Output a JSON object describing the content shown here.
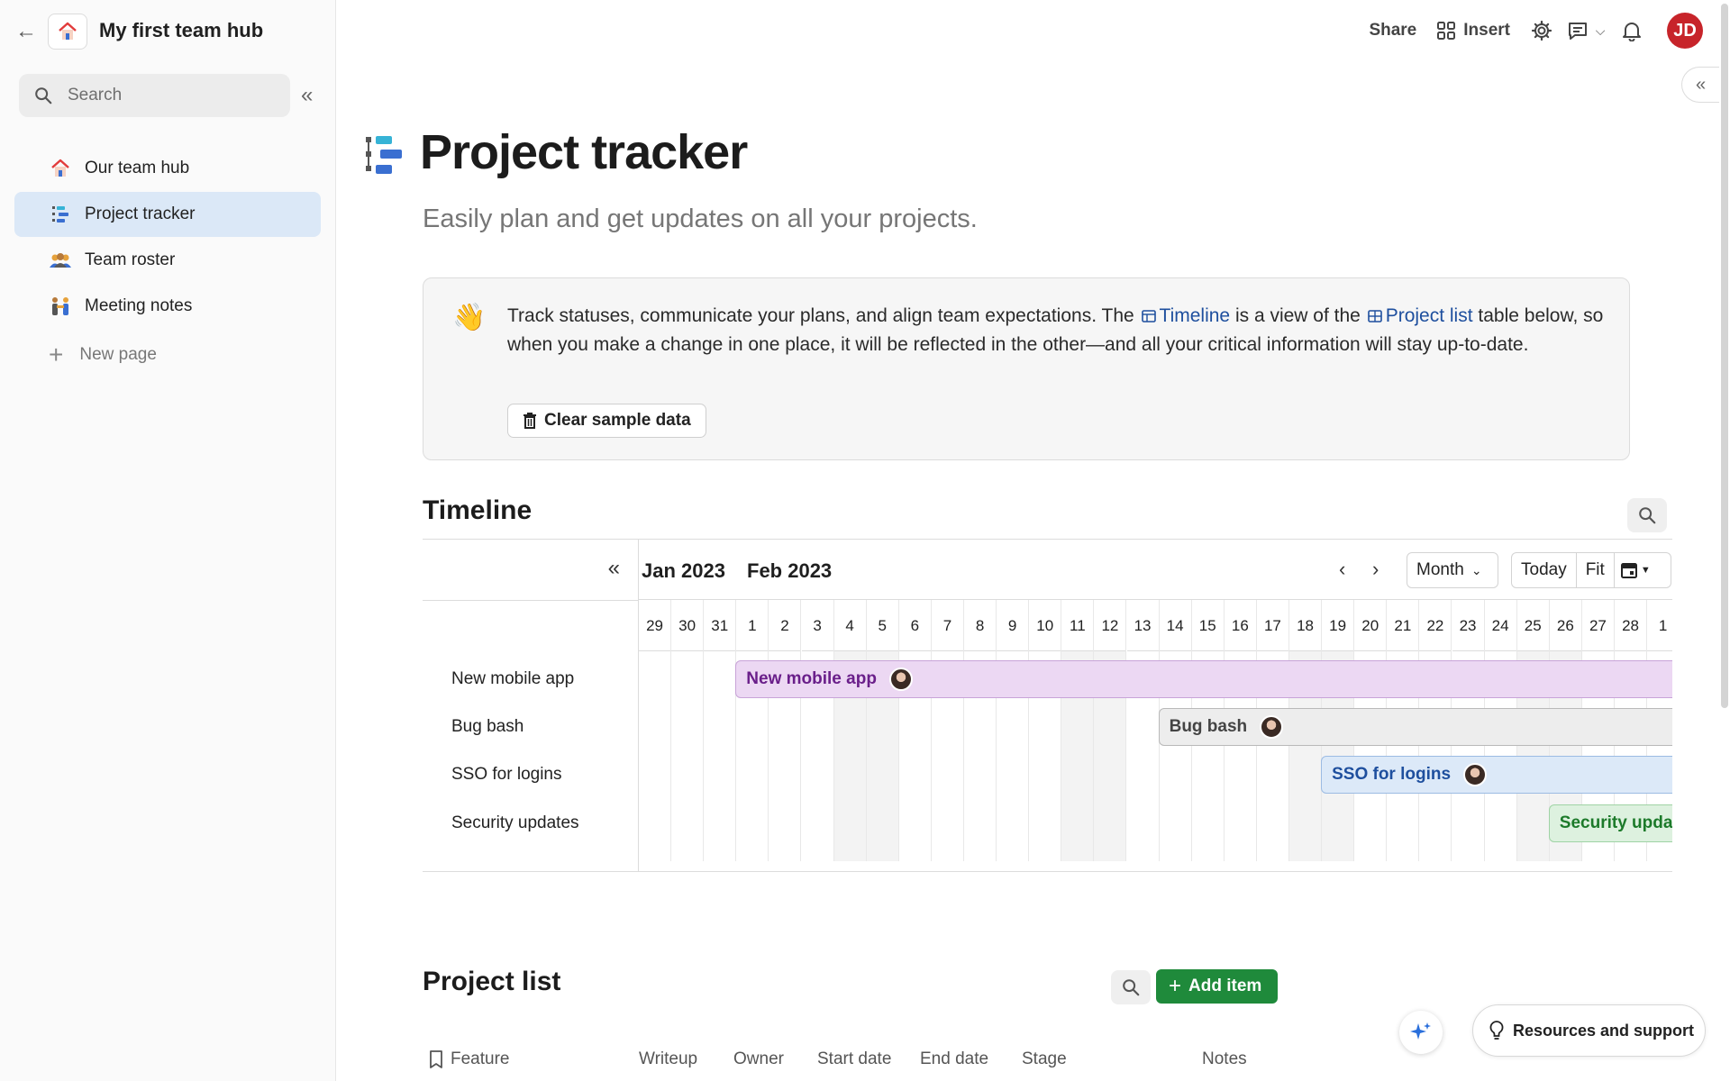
{
  "app": {
    "hub_title": "My first team hub"
  },
  "sidebar": {
    "search_placeholder": "Search",
    "items": [
      {
        "label": "Our team hub",
        "icon": "house-icon"
      },
      {
        "label": "Project tracker",
        "icon": "tracker-icon",
        "active": true
      },
      {
        "label": "Team roster",
        "icon": "people-icon"
      },
      {
        "label": "Meeting notes",
        "icon": "meeting-icon"
      }
    ],
    "new_page_label": "New page"
  },
  "topbar": {
    "share_label": "Share",
    "insert_label": "Insert",
    "avatar_initials": "JD",
    "avatar_color": "#c7242a"
  },
  "page": {
    "title": "Project tracker",
    "subtitle": "Easily plan and get updates on all your projects."
  },
  "callout": {
    "emoji": "👋",
    "text_1": "Track statuses, communicate your plans, and align team expectations. The",
    "link_timeline": "Timeline",
    "text_2": "is a view of the",
    "link_project_list": "Project list",
    "text_3": "table below, so when you make a change in one place, it will be reflected in the other—and all your critical information will stay up-to-date.",
    "clear_button": "Clear sample data"
  },
  "timeline": {
    "heading": "Timeline",
    "months": [
      "Jan 2023",
      "Feb 2023"
    ],
    "view_select": "Month",
    "today_label": "Today",
    "fit_label": "Fit",
    "days": [
      "29",
      "30",
      "31",
      "1",
      "2",
      "3",
      "4",
      "5",
      "6",
      "7",
      "8",
      "9",
      "10",
      "11",
      "12",
      "13",
      "14",
      "15",
      "16",
      "17",
      "18",
      "19",
      "20",
      "21",
      "22",
      "23",
      "24",
      "25",
      "26",
      "27",
      "28",
      "1"
    ],
    "weekend_indices": [
      6,
      7,
      13,
      14,
      20,
      21,
      27,
      28
    ],
    "rows": [
      {
        "label": "New mobile app",
        "bar_label": "New mobile app",
        "start_index": 3,
        "color": "purple"
      },
      {
        "label": "Bug bash",
        "bar_label": "Bug bash",
        "start_index": 16,
        "color": "gray"
      },
      {
        "label": "SSO for logins",
        "bar_label": "SSO for logins",
        "start_index": 21,
        "color": "blue"
      },
      {
        "label": "Security updates",
        "bar_label": "Security updates",
        "start_index": 28,
        "color": "green"
      }
    ]
  },
  "project_list": {
    "heading": "Project list",
    "add_button": "Add item",
    "columns": [
      "Feature",
      "Writeup",
      "Owner",
      "Start date",
      "End date",
      "Stage",
      "Notes"
    ]
  },
  "footer": {
    "resources_label": "Resources and support"
  }
}
